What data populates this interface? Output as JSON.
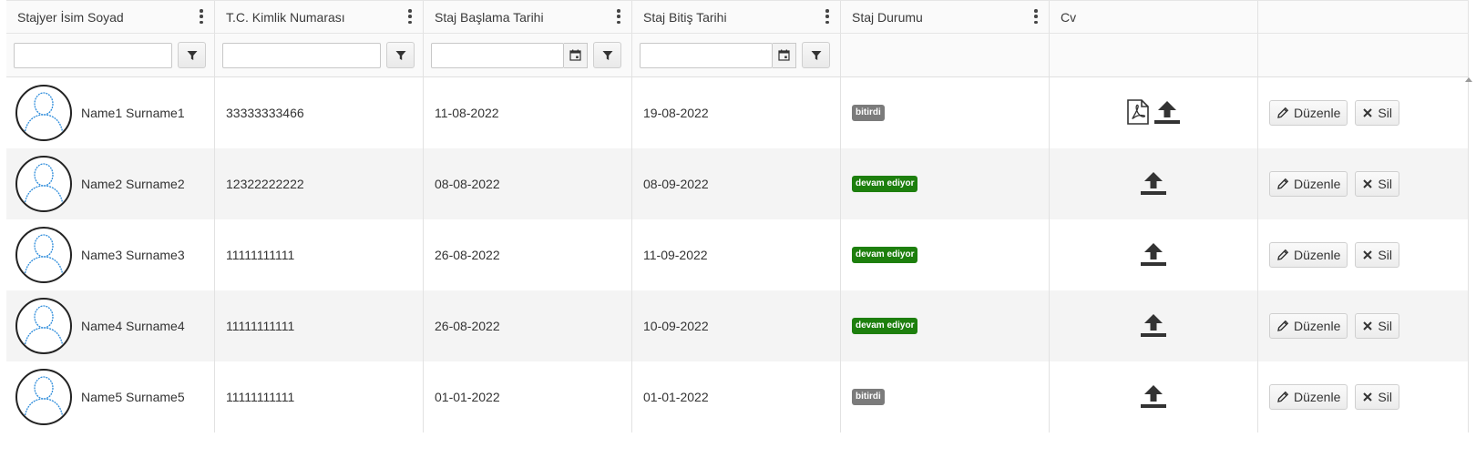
{
  "columns": [
    {
      "label": "Stajyer İsim Soyad"
    },
    {
      "label": "T.C. Kimlik Numarası"
    },
    {
      "label": "Staj Başlama Tarihi"
    },
    {
      "label": "Staj Bitiş Tarihi"
    },
    {
      "label": "Staj Durumu"
    },
    {
      "label": "Cv"
    },
    {
      "label": ""
    }
  ],
  "filters": {
    "name": "",
    "tc": "",
    "start": "",
    "end": ""
  },
  "actions": {
    "edit_label": "Düzenle",
    "delete_label": "Sil"
  },
  "colors": {
    "status_done": "#7b7b7b",
    "status_ongoing": "#1d7f0d"
  },
  "rows": [
    {
      "name": "Name1 Surname1",
      "tc": "33333333466",
      "start": "11-08-2022",
      "end": "19-08-2022",
      "status": "bitirdi",
      "status_kind": "done",
      "has_pdf": true
    },
    {
      "name": "Name2 Surname2",
      "tc": "12322222222",
      "start": "08-08-2022",
      "end": "08-09-2022",
      "status": "devam ediyor",
      "status_kind": "ongoing",
      "has_pdf": false
    },
    {
      "name": "Name3 Surname3",
      "tc": "11111111111",
      "start": "26-08-2022",
      "end": "11-09-2022",
      "status": "devam ediyor",
      "status_kind": "ongoing",
      "has_pdf": false
    },
    {
      "name": "Name4 Surname4",
      "tc": "11111111111",
      "start": "26-08-2022",
      "end": "10-09-2022",
      "status": "devam ediyor",
      "status_kind": "ongoing",
      "has_pdf": false
    },
    {
      "name": "Name5 Surname5",
      "tc": "11111111111",
      "start": "01-01-2022",
      "end": "01-01-2022",
      "status": "bitirdi",
      "status_kind": "done",
      "has_pdf": false
    }
  ]
}
